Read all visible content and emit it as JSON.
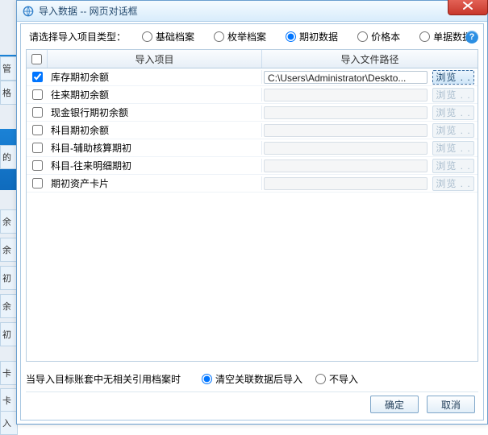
{
  "window": {
    "title": "导入数据 -- 网页对话框",
    "close": "×",
    "help": "?"
  },
  "type_row": {
    "label": "请选择导入项目类型：",
    "options": [
      "基础档案",
      "枚举档案",
      "期初数据",
      "价格本",
      "单据数据"
    ],
    "selected_index": 2
  },
  "grid": {
    "head_item": "导入项目",
    "head_path": "导入文件路径",
    "rows": [
      {
        "checked": true,
        "label": "库存期初余额",
        "path": "C:\\Users\\Administrator\\Deskto...",
        "enabled": true
      },
      {
        "checked": false,
        "label": "往来期初余额",
        "path": "",
        "enabled": false
      },
      {
        "checked": false,
        "label": "现金银行期初余额",
        "path": "",
        "enabled": false
      },
      {
        "checked": false,
        "label": "科目期初余额",
        "path": "",
        "enabled": false
      },
      {
        "checked": false,
        "label": "科目-辅助核算期初",
        "path": "",
        "enabled": false
      },
      {
        "checked": false,
        "label": "科目-往来明细期初",
        "path": "",
        "enabled": false
      },
      {
        "checked": false,
        "label": "期初资产卡片",
        "path": "",
        "enabled": false
      }
    ],
    "browse_label": "浏览 . ."
  },
  "assoc": {
    "label": "当导入目标账套中无相关引用档案时",
    "options": [
      "清空关联数据后导入",
      "不导入"
    ],
    "selected_index": 0
  },
  "buttons": {
    "ok": "确定",
    "cancel": "取消"
  },
  "bg_labels": [
    "管",
    "格",
    "的手",
    "余额",
    "余额",
    "初效",
    "余额",
    "初效",
    "卡单",
    "卡单",
    "入库"
  ]
}
